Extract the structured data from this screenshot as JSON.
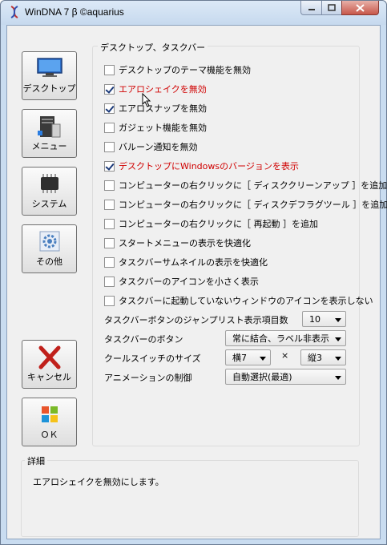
{
  "window": {
    "title": "WinDNA 7 β ©aquarius"
  },
  "sidebar": {
    "buttons": [
      {
        "label": "デスクトップ",
        "icon": "monitor-icon"
      },
      {
        "label": "メニュー",
        "icon": "computer-tower-icon"
      },
      {
        "label": "システム",
        "icon": "chip-icon"
      },
      {
        "label": "その他",
        "icon": "gear-icon"
      },
      {
        "label": "キャンセル",
        "icon": "red-x-icon"
      },
      {
        "label": "ＯＫ",
        "icon": "windows-logo-icon"
      }
    ]
  },
  "group": {
    "label": "デスクトップ、タスクバー",
    "options": [
      {
        "label": "デスクトップのテーマ機能を無効",
        "checked": false,
        "highlight": false
      },
      {
        "label": "エアロシェイクを無効",
        "checked": true,
        "highlight": true
      },
      {
        "label": "エアロスナップを無効",
        "checked": true,
        "highlight": false
      },
      {
        "label": "ガジェット機能を無効",
        "checked": false,
        "highlight": false
      },
      {
        "label": "バルーン通知を無効",
        "checked": false,
        "highlight": false
      },
      {
        "label": "デスクトップにWindowsのバージョンを表示",
        "checked": true,
        "highlight": true
      },
      {
        "label": "コンピューターの右クリックに［ ディスククリーンアップ ］を追加",
        "checked": false,
        "highlight": false
      },
      {
        "label": "コンピューターの右クリックに［ ディスクデフラグツール ］を追加",
        "checked": false,
        "highlight": false
      },
      {
        "label": "コンピューターの右クリックに［ 再起動 ］を追加",
        "checked": false,
        "highlight": false
      },
      {
        "label": "スタートメニューの表示を快適化",
        "checked": false,
        "highlight": false
      },
      {
        "label": "タスクバーサムネイルの表示を快適化",
        "checked": false,
        "highlight": false
      },
      {
        "label": "タスクバーのアイコンを小さく表示",
        "checked": false,
        "highlight": false
      },
      {
        "label": "タスクバーに起動していないウィンドウのアイコンを表示しない",
        "checked": false,
        "highlight": false
      }
    ],
    "settings": {
      "jumplist_label": "タスクバーボタンのジャンプリスト表示項目数",
      "jumplist_value": "10",
      "taskbar_button_label": "タスクバーのボタン",
      "taskbar_button_value": "常に結合、ラベル非表示",
      "coolswitch_label": "クールスイッチのサイズ",
      "coolswitch_width": "横7",
      "times": "×",
      "coolswitch_height": "縦3",
      "animation_label": "アニメーションの制御",
      "animation_value": "自動選択(最適)"
    }
  },
  "details": {
    "label": "詳細",
    "text": "エアロシェイクを無効にします。"
  },
  "colors": {
    "highlight_text": "#d00000",
    "window_frame": "#c9dcf0"
  }
}
